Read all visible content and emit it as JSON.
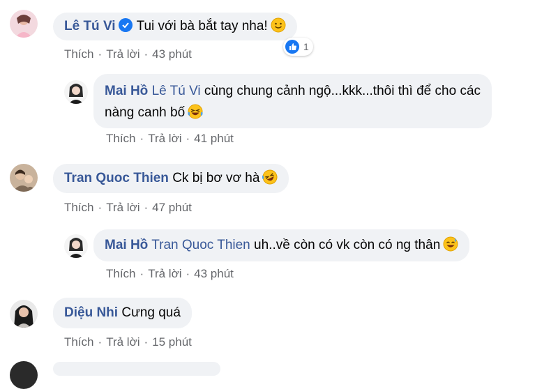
{
  "comments": [
    {
      "author": "Lê Tú Vi",
      "text": "Tui với bà bắt tay nha!",
      "emoji": "slightly-smiling-emoji",
      "verified": true,
      "reaction_count": "1",
      "like_label": "Thích",
      "reply_label": "Trả lời",
      "time": "43 phút",
      "reply": {
        "author": "Mai Hồ",
        "tag": "Lê Tú Vi",
        "text_line1": "cùng chung cảnh ngộ...kkk...thôi thì để cho các",
        "text_line2": "nàng canh bố",
        "emoji": "laughing-tears-emoji",
        "like_label": "Thích",
        "reply_label": "Trả lời",
        "time": "41 phút"
      }
    },
    {
      "author": "Tran Quoc Thien",
      "text": "Ck bị bơ vơ hà",
      "emoji": "rolling-laughing-emoji",
      "like_label": "Thích",
      "reply_label": "Trả lời",
      "time": "47 phút",
      "reply": {
        "author": "Mai Hồ",
        "tag": "Tran Quoc Thien",
        "text": "uh..về còn có vk còn có ng thân",
        "emoji": "sweat-smile-emoji",
        "like_label": "Thích",
        "reply_label": "Trả lời",
        "time": "43 phút"
      }
    },
    {
      "author": "Diệu Nhi",
      "text": "Cưng quá",
      "like_label": "Thích",
      "reply_label": "Trả lời",
      "time": "15 phút"
    }
  ],
  "colors": {
    "bubble": "#f0f2f5",
    "name": "#385898",
    "meta": "#65676b",
    "like_blue": "#1877f2"
  }
}
